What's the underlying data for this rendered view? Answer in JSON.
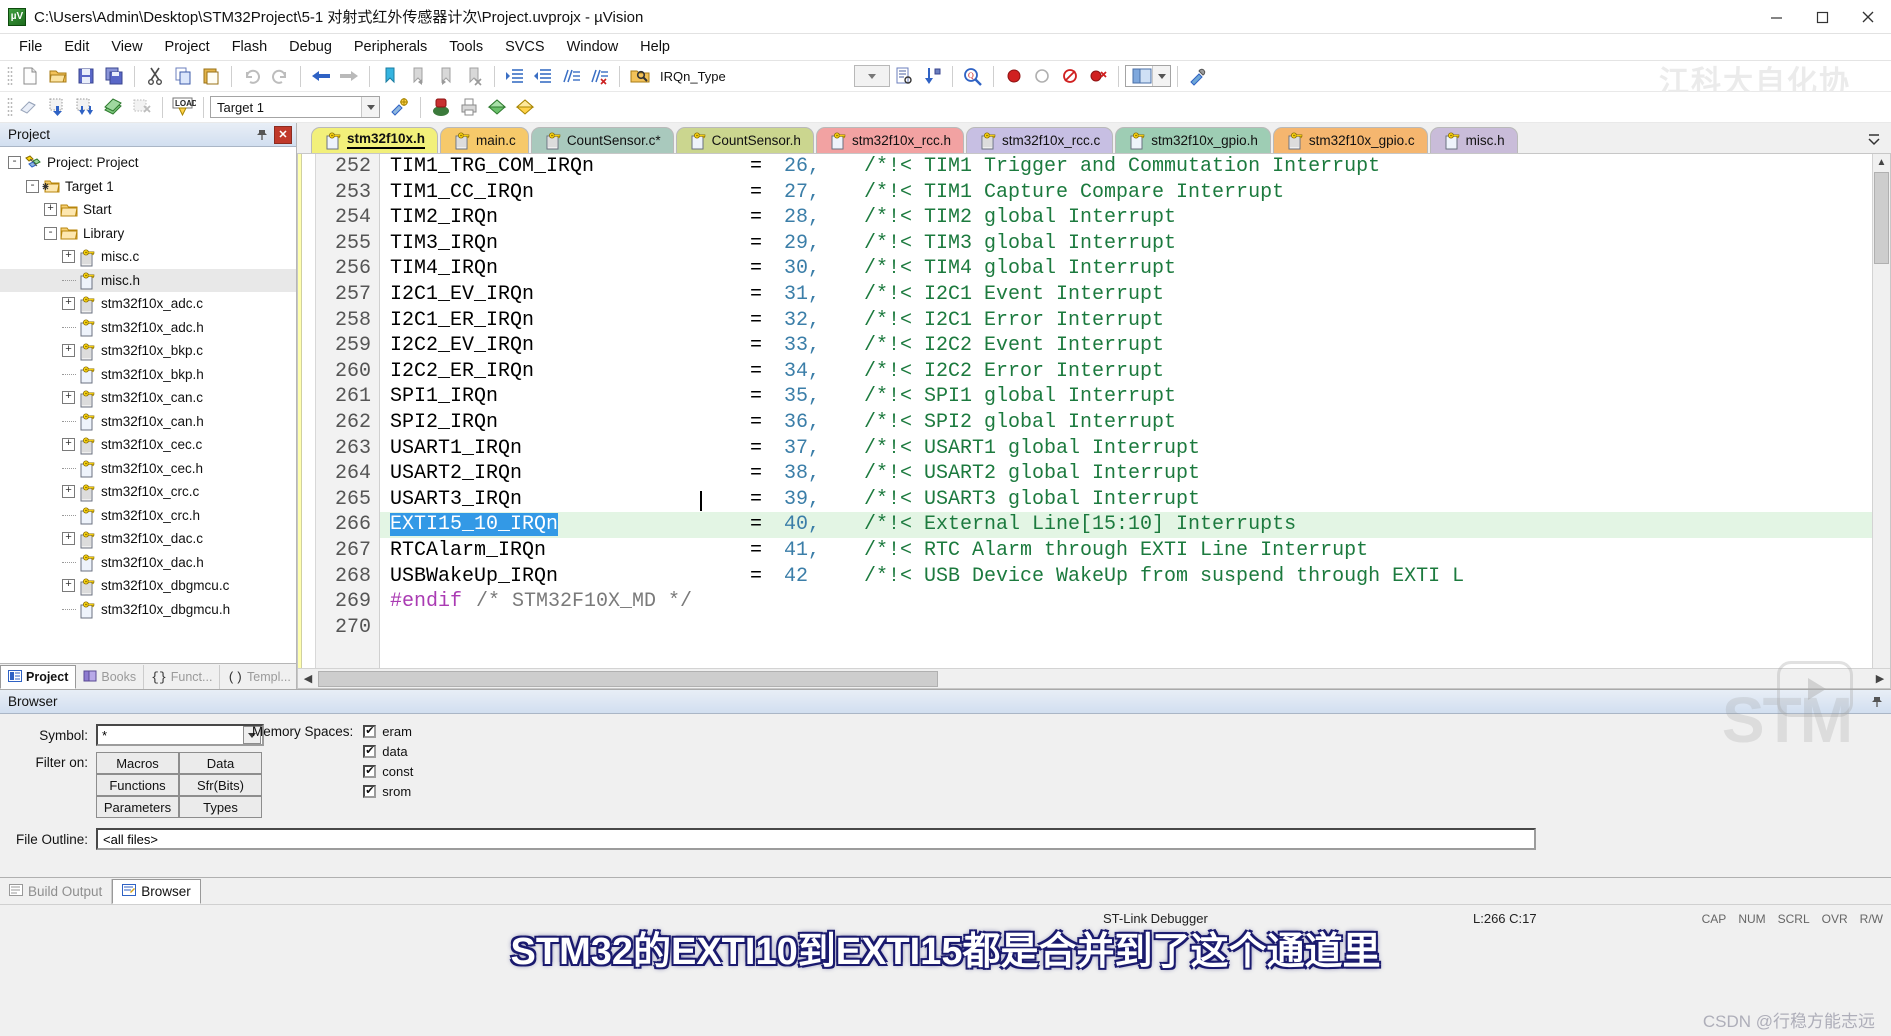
{
  "window": {
    "title": "C:\\Users\\Admin\\Desktop\\STM32Project\\5-1 对射式红外传感器计次\\Project.uvprojx - µVision",
    "app_icon": "uvision-icon",
    "minimize": "–",
    "maximize": "□",
    "close": "✕"
  },
  "menu": [
    "File",
    "Edit",
    "View",
    "Project",
    "Flash",
    "Debug",
    "Peripherals",
    "Tools",
    "SVCS",
    "Window",
    "Help"
  ],
  "toolbar_main": {
    "irqn_combo_value": "IRQn_Type",
    "icons": [
      "new-file-icon",
      "open-file-icon",
      "save-icon",
      "save-all-icon",
      "cut-icon",
      "copy-icon",
      "paste-icon",
      "undo-icon",
      "redo-icon",
      "navigate-back-icon",
      "navigate-forward-icon",
      "bookmark-toggle-icon",
      "bookmark-prev-icon",
      "bookmark-next-icon",
      "bookmark-clear-icon",
      "indent-icon",
      "outdent-icon",
      "comment-icon",
      "uncomment-icon",
      "find-in-files-icon",
      "browse-symbol-icon",
      "go-to-definition-icon",
      "find-icon",
      "insert-breakpoint-icon",
      "kill-breakpoint-icon",
      "disable-breakpoint-icon",
      "kill-all-breakpoints-icon",
      "window-layout-icon",
      "configure-icon"
    ]
  },
  "toolbar_build": {
    "target_value": "Target 1",
    "icons": [
      "translate-icon",
      "build-icon",
      "rebuild-icon",
      "batch-build-icon",
      "stop-build-icon",
      "download-icon",
      "target-options-icon",
      "manage-components-icon",
      "start-debug-icon",
      "printer-icon",
      "manage-project-items-icon"
    ]
  },
  "project_pane": {
    "header": "Project",
    "pin_icon": "pin-icon",
    "close_icon": "close-icon",
    "tree": [
      {
        "depth": 0,
        "expander": "-",
        "icon": "project-icon",
        "label": "Project: Project"
      },
      {
        "depth": 1,
        "expander": "-",
        "icon": "target-folder-icon",
        "label": "Target 1"
      },
      {
        "depth": 2,
        "expander": "+",
        "icon": "folder-icon",
        "label": "Start"
      },
      {
        "depth": 2,
        "expander": "-",
        "icon": "folder-icon",
        "label": "Library"
      },
      {
        "depth": 3,
        "expander": "+",
        "icon": "source-file-icon",
        "label": "misc.c"
      },
      {
        "depth": 3,
        "expander": "",
        "icon": "header-file-icon",
        "label": "misc.h",
        "selected": true
      },
      {
        "depth": 3,
        "expander": "+",
        "icon": "source-file-icon",
        "label": "stm32f10x_adc.c"
      },
      {
        "depth": 3,
        "expander": "",
        "icon": "header-file-icon",
        "label": "stm32f10x_adc.h"
      },
      {
        "depth": 3,
        "expander": "+",
        "icon": "source-file-icon",
        "label": "stm32f10x_bkp.c"
      },
      {
        "depth": 3,
        "expander": "",
        "icon": "header-file-icon",
        "label": "stm32f10x_bkp.h"
      },
      {
        "depth": 3,
        "expander": "+",
        "icon": "source-file-icon",
        "label": "stm32f10x_can.c"
      },
      {
        "depth": 3,
        "expander": "",
        "icon": "header-file-icon",
        "label": "stm32f10x_can.h"
      },
      {
        "depth": 3,
        "expander": "+",
        "icon": "source-file-icon",
        "label": "stm32f10x_cec.c"
      },
      {
        "depth": 3,
        "expander": "",
        "icon": "header-file-icon",
        "label": "stm32f10x_cec.h"
      },
      {
        "depth": 3,
        "expander": "+",
        "icon": "source-file-icon",
        "label": "stm32f10x_crc.c"
      },
      {
        "depth": 3,
        "expander": "",
        "icon": "header-file-icon",
        "label": "stm32f10x_crc.h"
      },
      {
        "depth": 3,
        "expander": "+",
        "icon": "source-file-icon",
        "label": "stm32f10x_dac.c"
      },
      {
        "depth": 3,
        "expander": "",
        "icon": "header-file-icon",
        "label": "stm32f10x_dac.h"
      },
      {
        "depth": 3,
        "expander": "+",
        "icon": "source-file-icon",
        "label": "stm32f10x_dbgmcu.c"
      },
      {
        "depth": 3,
        "expander": "",
        "icon": "header-file-icon",
        "label": "stm32f10x_dbgmcu.h"
      }
    ],
    "tabs": [
      {
        "label": "Project",
        "icon": "project-tab-icon",
        "active": true
      },
      {
        "label": "Books",
        "icon": "books-tab-icon",
        "active": false
      },
      {
        "label": "Funct...",
        "icon": "functions-tab-icon",
        "active": false
      },
      {
        "label": "Templ...",
        "icon": "templates-tab-icon",
        "active": false
      }
    ]
  },
  "editor": {
    "tabs": [
      {
        "label": "stm32f10x.h",
        "color": "#f2f07a",
        "icon": "header-file-icon",
        "active": true
      },
      {
        "label": "main.c",
        "color": "#f6c96a",
        "icon": "source-file-icon",
        "active": false
      },
      {
        "label": "CountSensor.c*",
        "color": "#a9c9bd",
        "icon": "source-file-icon",
        "active": false
      },
      {
        "label": "CountSensor.h",
        "color": "#cbd68f",
        "icon": "header-file-icon",
        "active": false
      },
      {
        "label": "stm32f10x_rcc.h",
        "color": "#f2a2a2",
        "icon": "header-file-icon",
        "active": false
      },
      {
        "label": "stm32f10x_rcc.c",
        "color": "#c7bfe3",
        "icon": "source-file-icon",
        "active": false
      },
      {
        "label": "stm32f10x_gpio.h",
        "color": "#9ecdb4",
        "icon": "header-file-icon",
        "active": false
      },
      {
        "label": "stm32f10x_gpio.c",
        "color": "#f5b66f",
        "icon": "source-file-icon",
        "active": false
      },
      {
        "label": "misc.h",
        "color": "#c9bcd9",
        "icon": "header-file-icon",
        "active": false
      }
    ],
    "overflow_icon": "tab-overflow-icon",
    "lines": [
      {
        "num": "252",
        "name": "TIM1_TRG_COM_IRQn",
        "eq": "=",
        "val": "26,",
        "comment": "/*!< TIM1 Trigger and Commutation Interrupt"
      },
      {
        "num": "253",
        "name": "TIM1_CC_IRQn",
        "eq": "=",
        "val": "27,",
        "comment": "/*!< TIM1 Capture Compare Interrupt"
      },
      {
        "num": "254",
        "name": "TIM2_IRQn",
        "eq": "=",
        "val": "28,",
        "comment": "/*!< TIM2 global Interrupt"
      },
      {
        "num": "255",
        "name": "TIM3_IRQn",
        "eq": "=",
        "val": "29,",
        "comment": "/*!< TIM3 global Interrupt"
      },
      {
        "num": "256",
        "name": "TIM4_IRQn",
        "eq": "=",
        "val": "30,",
        "comment": "/*!< TIM4 global Interrupt"
      },
      {
        "num": "257",
        "name": "I2C1_EV_IRQn",
        "eq": "=",
        "val": "31,",
        "comment": "/*!< I2C1 Event Interrupt"
      },
      {
        "num": "258",
        "name": "I2C1_ER_IRQn",
        "eq": "=",
        "val": "32,",
        "comment": "/*!< I2C1 Error Interrupt"
      },
      {
        "num": "259",
        "name": "I2C2_EV_IRQn",
        "eq": "=",
        "val": "33,",
        "comment": "/*!< I2C2 Event Interrupt"
      },
      {
        "num": "260",
        "name": "I2C2_ER_IRQn",
        "eq": "=",
        "val": "34,",
        "comment": "/*!< I2C2 Error Interrupt"
      },
      {
        "num": "261",
        "name": "SPI1_IRQn",
        "eq": "=",
        "val": "35,",
        "comment": "/*!< SPI1 global Interrupt"
      },
      {
        "num": "262",
        "name": "SPI2_IRQn",
        "eq": "=",
        "val": "36,",
        "comment": "/*!< SPI2 global Interrupt"
      },
      {
        "num": "263",
        "name": "USART1_IRQn",
        "eq": "=",
        "val": "37,",
        "comment": "/*!< USART1 global Interrupt"
      },
      {
        "num": "264",
        "name": "USART2_IRQn",
        "eq": "=",
        "val": "38,",
        "comment": "/*!< USART2 global Interrupt"
      },
      {
        "num": "265",
        "name": "USART3_IRQn",
        "eq": "=",
        "val": "39,",
        "comment": "/*!< USART3 global Interrupt"
      },
      {
        "num": "266",
        "name": "EXTI15_10_IRQn",
        "eq": "=",
        "val": "40,",
        "comment": "/*!< External Line[15:10] Interrupts",
        "highlighted": true,
        "selected": true
      },
      {
        "num": "267",
        "name": "RTCAlarm_IRQn",
        "eq": "=",
        "val": "41,",
        "comment": "/*!< RTC Alarm through EXTI Line Interrupt"
      },
      {
        "num": "268",
        "name": "USBWakeUp_IRQn",
        "eq": "=",
        "val": "42",
        "comment": "/*!< USB Device WakeUp from suspend through EXTI L"
      },
      {
        "num": "269",
        "preproc": "#endif",
        "comment_plain": "/* STM32F10X_MD */"
      },
      {
        "num": "270"
      }
    ]
  },
  "browser": {
    "header": "Browser",
    "symbol_label": "Symbol:",
    "symbol_value": "*",
    "filter_label": "Filter on:",
    "filter_buttons": [
      "Macros",
      "Data",
      "Functions",
      "Sfr(Bits)",
      "Parameters",
      "Types"
    ],
    "memory_spaces_label": "Memory Spaces:",
    "memory_spaces": [
      {
        "label": "eram",
        "checked": true
      },
      {
        "label": "data",
        "checked": true
      },
      {
        "label": "const",
        "checked": true
      },
      {
        "label": "srom",
        "checked": true
      }
    ],
    "file_outline_label": "File Outline:",
    "file_outline_value": "<all files>",
    "tabs": [
      {
        "label": "Build Output",
        "icon": "build-output-icon",
        "active": false
      },
      {
        "label": "Browser",
        "icon": "browser-icon",
        "active": true
      }
    ]
  },
  "statusbar": {
    "debugger": "ST-Link Debugger",
    "position": "L:266 C:17",
    "indicators": [
      "CAP",
      "NUM",
      "SCRL",
      "OVR",
      "R/W"
    ]
  },
  "overlays": {
    "subtitle": "STM32的EXTI10到EXTI15都是合并到了这个通道里",
    "csdn_watermark": "CSDN @行稳方能志远",
    "stm_watermark": "STM",
    "toolbar_watermark": "江科大自化协"
  }
}
